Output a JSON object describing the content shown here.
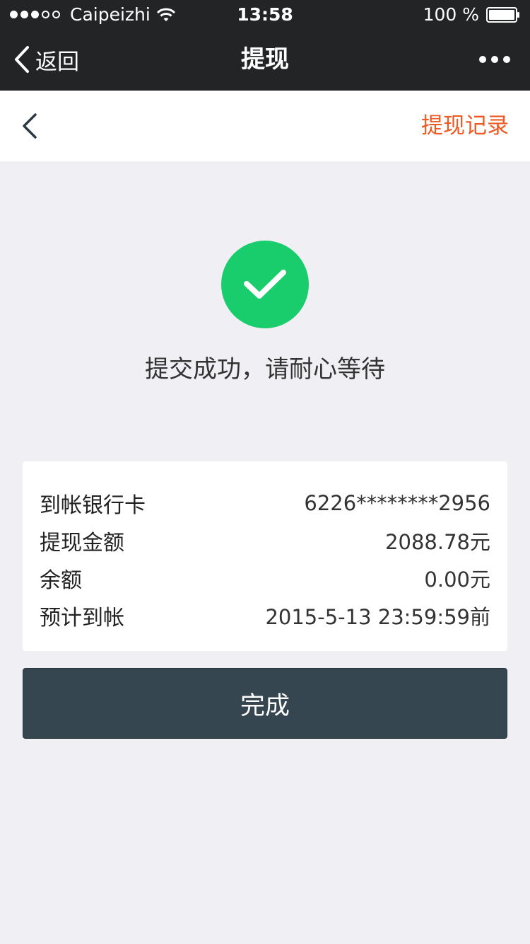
{
  "status_bar": {
    "carrier": "Caipeizhi",
    "time": "13:58",
    "battery": "100 %",
    "signal_bars_full": 3,
    "signal_bars_total": 5
  },
  "nav_bar": {
    "back_label": "返回",
    "title": "提现"
  },
  "sub_header": {
    "record_link": "提现记录",
    "record_color": "#ee5a24"
  },
  "result": {
    "message": "提交成功，请耐心等待",
    "icon": "check-circle-icon",
    "icon_color": "#19cc6c"
  },
  "details": [
    {
      "label": "到帐银行卡",
      "value": "6226********2956"
    },
    {
      "label": "提现金额",
      "value": "2088.78元"
    },
    {
      "label": "余额",
      "value": "0.00元"
    },
    {
      "label": "预计到帐",
      "value": "2015-5-13 23:59:59前"
    }
  ],
  "done_button": {
    "label": "完成",
    "color": "#364650"
  }
}
